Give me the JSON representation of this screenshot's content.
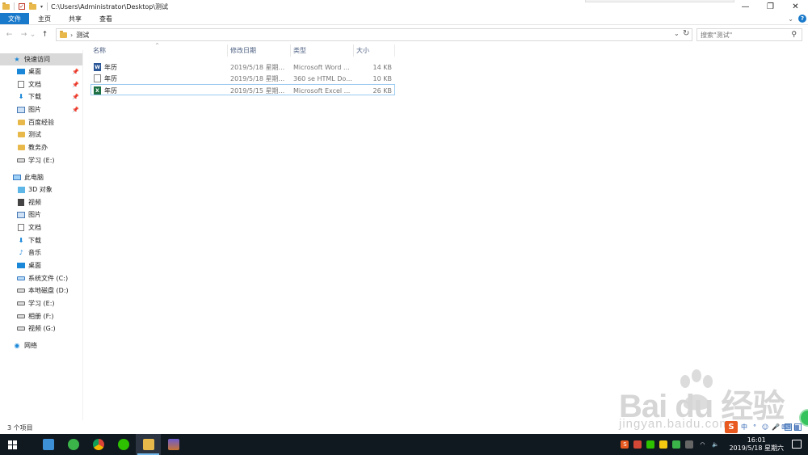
{
  "titlebar": {
    "path_title": "C:\\Users\\Administrator\\Desktop\\测试",
    "minimize": "—",
    "maximize": "❐",
    "close": "✕"
  },
  "ribbon": {
    "tabs": [
      {
        "label": "文件",
        "active": true
      },
      {
        "label": "主页"
      },
      {
        "label": "共享"
      },
      {
        "label": "查看"
      }
    ],
    "help": "?"
  },
  "nav": {
    "back": "←",
    "forward": "→",
    "recent": "⌄",
    "up": "↑",
    "crumb_sep": "›",
    "path": "测试",
    "search_placeholder": "搜索\"测试\""
  },
  "sidebar": {
    "quick_access": "快速访问",
    "quick_items": [
      {
        "label": "桌面",
        "icon": "desktop-icon",
        "pinned": true
      },
      {
        "label": "文档",
        "icon": "document-icon",
        "pinned": true
      },
      {
        "label": "下载",
        "icon": "download-icon",
        "pinned": true
      },
      {
        "label": "图片",
        "icon": "picture-icon",
        "pinned": true
      },
      {
        "label": "百度经验",
        "icon": "folder-icon"
      },
      {
        "label": "测试",
        "icon": "folder-icon"
      },
      {
        "label": "教务办",
        "icon": "folder-icon"
      },
      {
        "label": "学习 (E:)",
        "icon": "drive-icon"
      }
    ],
    "this_pc": "此电脑",
    "pc_items": [
      {
        "label": "3D 对象",
        "icon": "3d-objects-icon"
      },
      {
        "label": "视频",
        "icon": "video-icon"
      },
      {
        "label": "图片",
        "icon": "picture-icon"
      },
      {
        "label": "文档",
        "icon": "document-icon"
      },
      {
        "label": "下载",
        "icon": "download-icon"
      },
      {
        "label": "音乐",
        "icon": "music-icon"
      },
      {
        "label": "桌面",
        "icon": "desktop-icon"
      },
      {
        "label": "系统文件 (C:)",
        "icon": "system-drive-icon"
      },
      {
        "label": "本地磁盘 (D:)",
        "icon": "drive-icon"
      },
      {
        "label": "学习 (E:)",
        "icon": "drive-icon"
      },
      {
        "label": "相册 (F:)",
        "icon": "drive-icon"
      },
      {
        "label": "视频 (G:)",
        "icon": "drive-icon"
      }
    ],
    "network": "网络"
  },
  "columns": {
    "name": "名称",
    "modified": "修改日期",
    "type": "类型",
    "size": "大小"
  },
  "files": [
    {
      "name": "年历",
      "modified": "2019/5/18 星期...",
      "type": "Microsoft Word ...",
      "size": "14 KB",
      "icon": "word-file-icon"
    },
    {
      "name": "年历",
      "modified": "2019/5/18 星期...",
      "type": "360 se HTML Do...",
      "size": "10 KB",
      "icon": "html-file-icon"
    },
    {
      "name": "年历",
      "modified": "2019/5/15 星期...",
      "type": "Microsoft Excel ...",
      "size": "26 KB",
      "icon": "excel-file-icon"
    }
  ],
  "status": {
    "count": "3 个项目"
  },
  "taskbar": {
    "time": "16:01",
    "date": "2019/5/18 星期六",
    "apps": [
      "start-icon",
      "app-blue-icon",
      "app-green-icon",
      "chrome-icon",
      "wechat-icon",
      "file-explorer-icon",
      "photo-icon"
    ]
  },
  "ime": {
    "logo": "S"
  },
  "watermark": {
    "brand": "Bai du 经验",
    "url": "jingyan.baidu.com"
  },
  "colors": {
    "accent": "#1979ca",
    "taskbar": "#101820"
  }
}
